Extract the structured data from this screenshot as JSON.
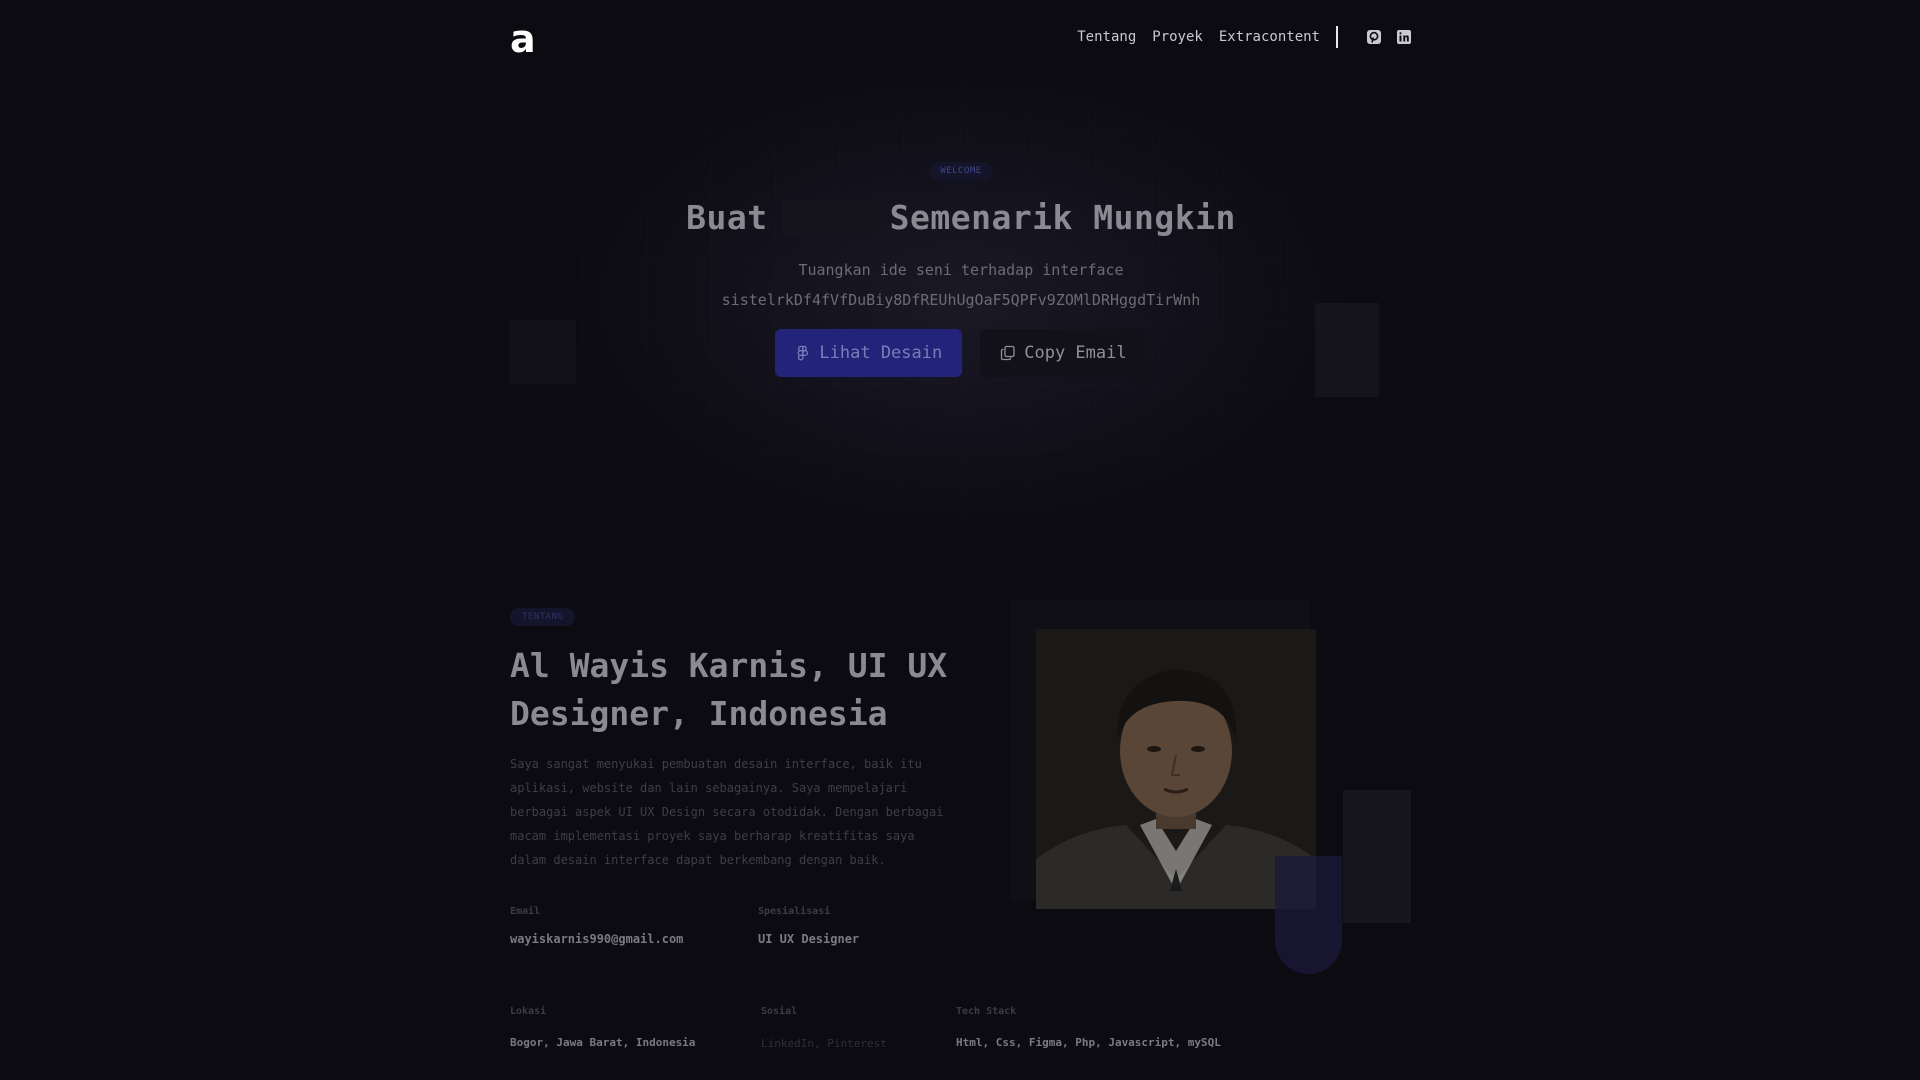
{
  "brand": {
    "logo": "a"
  },
  "nav": {
    "links": [
      "Tentang",
      "Proyek",
      "Extracontent"
    ],
    "icons": [
      "pinterest-icon",
      "linkedin-icon"
    ]
  },
  "hero": {
    "pill": "WELCOME",
    "title_before": "Buat",
    "title_after": "Semenarik Mungkin",
    "subtitle_line1": "Tuangkan ide seni terhadap interface",
    "subtitle_line2": "sistelrkDf4fVfDuBiy8DfREUhUgOaF5QPFv9ZOMlDRHggdTirWnh",
    "primary_button": "Lihat Desain",
    "primary_button_icon": "figma-icon",
    "secondary_button": "Copy Email",
    "secondary_button_icon": "copy-icon"
  },
  "about": {
    "pill": "TENTANG",
    "title": "Al Wayis Karnis, UI UX Designer, Indonesia",
    "description": "Saya sangat menyukai pembuatan desain interface, baik itu aplikasi, website dan lain sebagainya. Saya mempelajari berbagai aspek UI UX Design secara otodidak. Dengan berbagai macam implementasi proyek saya berharap kreatifitas saya dalam desain interface dapat berkembang dengan baik.",
    "email_label": "Email",
    "email_value": "wayiskarnis990@gmail.com",
    "specialization_label": "Spesialisasi",
    "specialization_value": "UI UX Designer",
    "location_label": "Lokasi",
    "location_value": "Bogor, Jawa Barat, Indonesia",
    "social_label": "Sosial",
    "social_value": "LinkedIn, Pinterest",
    "tech_label": "Tech Stack",
    "tech_value": "Html, Css, Figma, Php, Javascript, mySQL"
  },
  "colors": {
    "background": "#0c0b12",
    "accent": "#24237a",
    "text_primary": "#8a8a92"
  }
}
